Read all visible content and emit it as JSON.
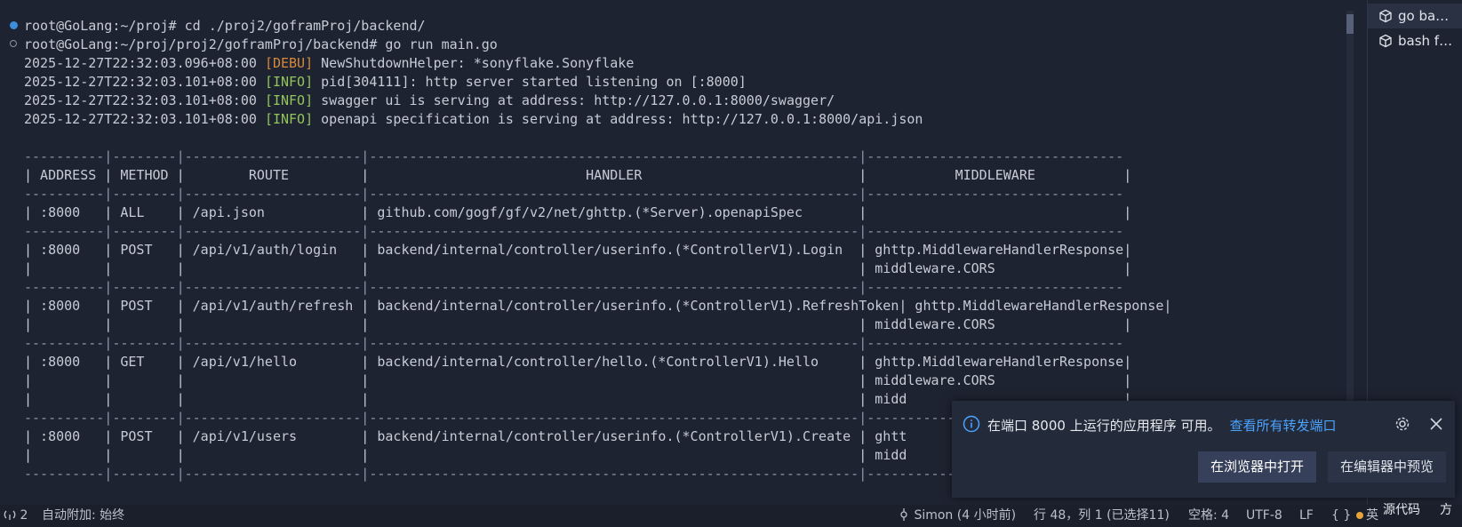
{
  "terminal": {
    "prompt_lines": [
      "root@GoLang:~/proj# cd ./proj2/goframProj/backend/",
      "root@GoLang:~/proj/proj2/goframProj/backend# go run main.go"
    ],
    "logs": [
      {
        "timestamp": "2025-12-27T22:32:03.096+08:00",
        "level": "[DEBU]",
        "message": "NewShutdownHelper: *sonyflake.Sonyflake"
      },
      {
        "timestamp": "2025-12-27T22:32:03.101+08:00",
        "level": "[INFO]",
        "message": "pid[304111]: http server started listening on [:8000]"
      },
      {
        "timestamp": "2025-12-27T22:32:03.101+08:00",
        "level": "[INFO]",
        "message": "swagger ui is serving at address: http://127.0.0.1:8000/swagger/"
      },
      {
        "timestamp": "2025-12-27T22:32:03.101+08:00",
        "level": "[INFO]",
        "message": "openapi specification is serving at address: http://127.0.0.1:8000/api.json"
      }
    ],
    "table_headers": [
      "ADDRESS",
      "METHOD",
      "ROUTE",
      "HANDLER",
      "MIDDLEWARE"
    ],
    "table_rows": [
      {
        "address": ":8000",
        "method": "ALL",
        "route": "/api.json",
        "handler": "github.com/gogf/gf/v2/net/ghttp.(*Server).openapiSpec",
        "middleware": []
      },
      {
        "address": ":8000",
        "method": "POST",
        "route": "/api/v1/auth/login",
        "handler": "backend/internal/controller/userinfo.(*ControllerV1).Login",
        "middleware": [
          "ghttp.MiddlewareHandlerResponse",
          "middleware.CORS"
        ]
      },
      {
        "address": ":8000",
        "method": "POST",
        "route": "/api/v1/auth/refresh",
        "handler": "backend/internal/controller/userinfo.(*ControllerV1).RefreshToken",
        "middleware": [
          "ghttp.MiddlewareHandlerResponse",
          "middleware.CORS"
        ]
      },
      {
        "address": ":8000",
        "method": "GET",
        "route": "/api/v1/hello",
        "handler": "backend/internal/controller/hello.(*ControllerV1).Hello",
        "middleware": [
          "ghttp.MiddlewareHandlerResponse",
          "middleware.CORS",
          "midd"
        ]
      },
      {
        "address": ":8000",
        "method": "POST",
        "route": "/api/v1/users",
        "handler": "backend/internal/controller/userinfo.(*ControllerV1).Create",
        "middleware": [
          "ghtt",
          "midd"
        ]
      }
    ]
  },
  "terminal_tabs": [
    {
      "label": "go ba…",
      "icon": "cube-icon"
    },
    {
      "label": "bash f…",
      "icon": "cube-icon"
    }
  ],
  "notification": {
    "message": "在端口 8000 上运行的应用程序 可用。",
    "link": "查看所有转发端口",
    "primary_button": "在浏览器中打开",
    "secondary_button": "在编辑器中预览"
  },
  "statusbar": {
    "ports": "2",
    "auto_attach": "自动附加: 始终",
    "blame": "Simon (4 小时前)",
    "position": "行 48，列 1 (已选择11)",
    "spaces": "空格: 4",
    "encoding": "UTF-8",
    "eol": "LF",
    "braces": "{ }",
    "ime": "英",
    "source_code": "源代码",
    "extra": "方"
  },
  "colors": {
    "background": "#1e2331",
    "debug_level": "#d7883b",
    "info_level": "#92c55a",
    "link": "#4aa3ff"
  }
}
